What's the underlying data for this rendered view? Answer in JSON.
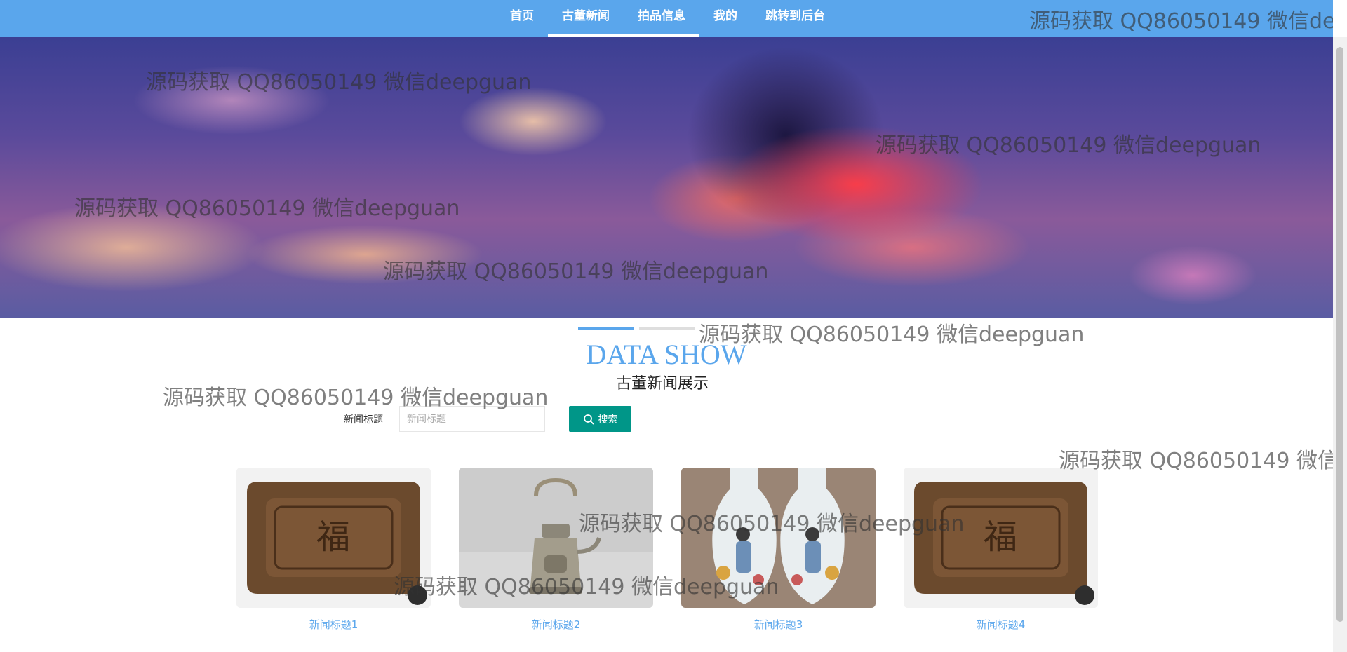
{
  "nav": {
    "items": [
      {
        "label": "首页"
      },
      {
        "label": "古董新闻"
      },
      {
        "label": "拍品信息"
      },
      {
        "label": "我的"
      },
      {
        "label": "跳转到后台"
      }
    ]
  },
  "section": {
    "title_en": "DATA SHOW",
    "title_cn": "古董新闻展示"
  },
  "search": {
    "label": "新闻标题",
    "placeholder": "新闻标题",
    "button_label": "搜索"
  },
  "cards": [
    {
      "title": "新闻标题1",
      "image": "wooden-tray"
    },
    {
      "title": "新闻标题2",
      "image": "metal-teapot"
    },
    {
      "title": "新闻标题3",
      "image": "porcelain-vases"
    },
    {
      "title": "新闻标题4",
      "image": "wooden-tray"
    }
  ],
  "watermark": {
    "text": "源码获取 QQ86050149 微信deepguan"
  },
  "colors": {
    "nav_bg": "#5aa6ec",
    "accent": "#5aa6ec",
    "search_button": "#009688"
  }
}
